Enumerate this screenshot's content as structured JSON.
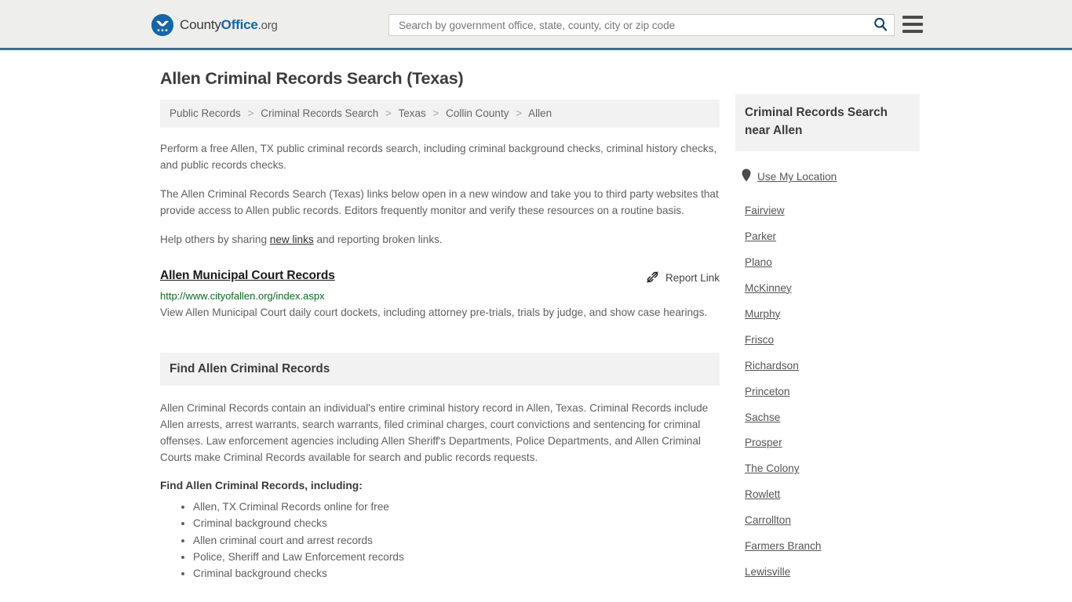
{
  "header": {
    "brand": {
      "part1": "County",
      "part2": "Office",
      "part3": ".org"
    },
    "search": {
      "placeholder": "Search by government office, state, county, city or zip code",
      "value": ""
    },
    "accent_color": "#33709e"
  },
  "main": {
    "title": "Allen Criminal Records Search (Texas)",
    "breadcrumb": [
      "Public Records",
      "Criminal Records Search",
      "Texas",
      "Collin County",
      "Allen"
    ],
    "breadcrumb_separator": ">",
    "paragraphs": [
      "Perform a free Allen, TX public criminal records search, including criminal background checks, criminal history checks, and public records checks.",
      "The Allen Criminal Records Search (Texas) links below open in a new window and take you to third party websites that provide access to Allen public records. Editors frequently monitor and verify these resources on a routine basis."
    ],
    "help_line": {
      "before": "Help others by sharing ",
      "link": "new links",
      "after": " and reporting broken links."
    },
    "entry": {
      "title": "Allen Municipal Court Records",
      "report_label": "Report Link",
      "url": "http://www.cityofallen.org/index.aspx",
      "description": "View Allen Municipal Court daily court dockets, including attorney pre-trials, trials by judge, and show case hearings.",
      "url_color": "#0a6b22"
    },
    "section": {
      "heading": "Find Allen Criminal Records",
      "body": "Allen Criminal Records contain an individual's entire criminal history record in Allen, Texas. Criminal Records include Allen arrests, arrest warrants, search warrants, filed criminal charges, court convictions and sentencing for criminal offenses. Law enforcement agencies including Allen Sheriff's Departments, Police Departments, and Allen Criminal Courts make Criminal Records available for search and public records requests.",
      "subheading": "Find Allen Criminal Records, including:",
      "bullets": [
        "Allen, TX Criminal Records online for free",
        "Criminal background checks",
        "Allen criminal court and arrest records",
        "Police, Sheriff and Law Enforcement records",
        "Criminal background checks"
      ]
    }
  },
  "sidebar": {
    "heading": "Criminal Records Search near Allen",
    "use_my_location": "Use My Location",
    "cities": [
      "Fairview",
      "Parker",
      "Plano",
      "McKinney",
      "Murphy",
      "Frisco",
      "Richardson",
      "Princeton",
      "Sachse",
      "Prosper",
      "The Colony",
      "Rowlett",
      "Carrollton",
      "Farmers Branch",
      "Lewisville"
    ]
  }
}
